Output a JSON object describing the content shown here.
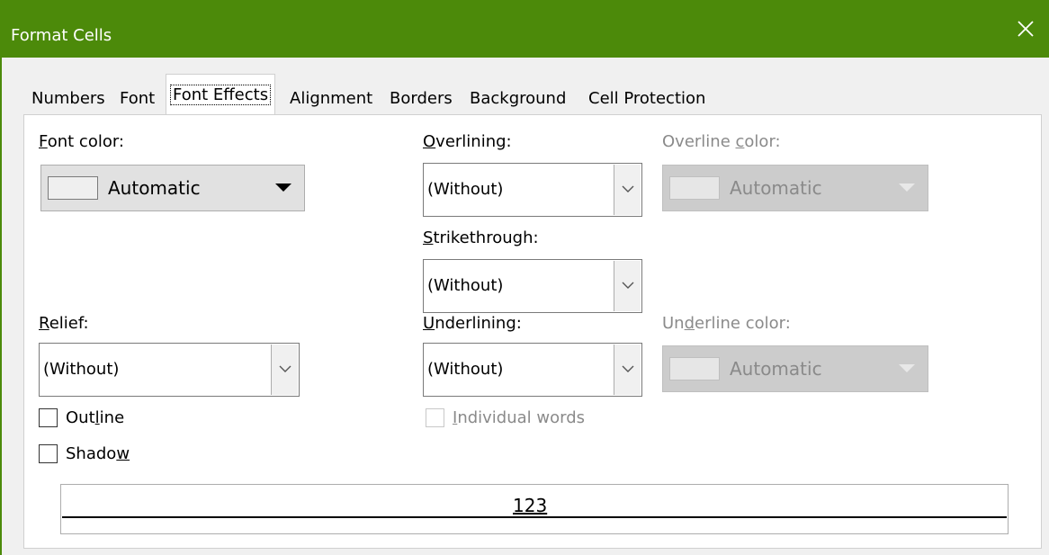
{
  "window": {
    "title": "Format Cells"
  },
  "tabs": [
    {
      "label": "Numbers"
    },
    {
      "label": "Font"
    },
    {
      "label": "Font Effects"
    },
    {
      "label": "Alignment"
    },
    {
      "label": "Borders"
    },
    {
      "label": "Background"
    },
    {
      "label": "Cell Protection"
    }
  ],
  "active_tab": "Font Effects",
  "font_color": {
    "label_key": "F",
    "label_rest": "ont color:",
    "value": "Automatic"
  },
  "overlining": {
    "label_key": "O",
    "label_rest": "verlining:",
    "value": "(Without)"
  },
  "overline_color": {
    "label_pre": "Overline ",
    "label_key": "c",
    "label_rest": "olor:",
    "value": "Automatic",
    "enabled": false
  },
  "strikethrough": {
    "label_key": "S",
    "label_rest": "trikethrough:",
    "value": "(Without)"
  },
  "relief": {
    "label_key": "R",
    "label_rest": "elief:",
    "value": "(Without)"
  },
  "underlining": {
    "label_key": "U",
    "label_rest": "nderlining:",
    "value": "(Without)"
  },
  "underline_color": {
    "label_pre": "Un",
    "label_key": "d",
    "label_rest": "erline color:",
    "value": "Automatic",
    "enabled": false
  },
  "individual_words": {
    "label_key": "I",
    "label_rest": "ndividual words",
    "checked": false,
    "enabled": false
  },
  "outline": {
    "label_pre": "Out",
    "label_key": "l",
    "label_rest": "ine",
    "checked": false
  },
  "shadow": {
    "label_pre": "Shado",
    "label_key": "w",
    "label_rest": "",
    "checked": false
  },
  "preview": {
    "text": "123"
  },
  "colors": {
    "titlebar": "#4c8a0a",
    "disabled_text": "#8a8a8a"
  },
  "icons": {
    "close": "close-icon",
    "dropdown": "chevron-down-icon",
    "color_dropdown": "triangle-down-icon"
  }
}
